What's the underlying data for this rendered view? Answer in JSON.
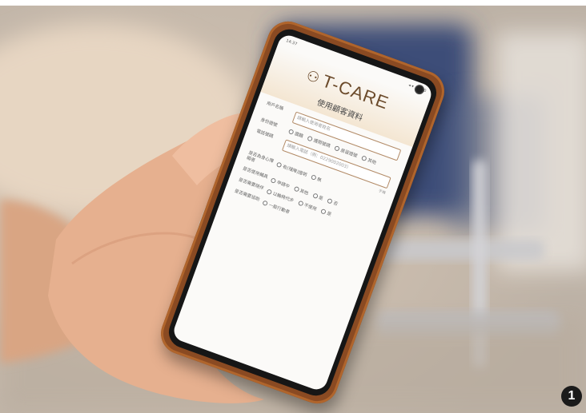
{
  "photo": {
    "description_colors": {
      "background_blur": "#cfc6bb",
      "phone_case": "#8a4a22",
      "skin": "#e8b594",
      "header_tint": "#f4e6d2",
      "brand_text": "#6b4a2a"
    },
    "badge": "1"
  },
  "app": {
    "status_left": "14:37",
    "status_right": "◂ ▾ ◢ 100",
    "logo_icon": "person-pair-icon",
    "brand": "T-CARE",
    "form_title": "使用顧客資料",
    "fields": {
      "name_label": "用戶名稱",
      "name_placeholder": "請輸入使用者姓名",
      "id_label": "身份證號",
      "id_opt1": "國籍",
      "id_opt2": "護照號碼",
      "id_opt3": "居留證號",
      "id_opt4": "其他",
      "phone_label": "電話號碼",
      "phone_placeholder": "請輸入電話（例：0229002003）",
      "phone_hint": "手機",
      "q1_label": "是否為身心障礙者",
      "q1_opt1": "有(殘障)證明",
      "q1_opt2": "無",
      "q2_label": "是否使用輔具",
      "q2_opt1": "申請中",
      "q2_opt2": "其他",
      "q2_opt3": "是",
      "q2_opt4": "否",
      "q3_label": "是否需要陪伴",
      "q3_opt1": "以輪椅代步",
      "q3_opt2": "不使用",
      "q3_opt3": "是",
      "q4_label": "是否需要協助",
      "q4_opt1": "一般行動者"
    }
  }
}
